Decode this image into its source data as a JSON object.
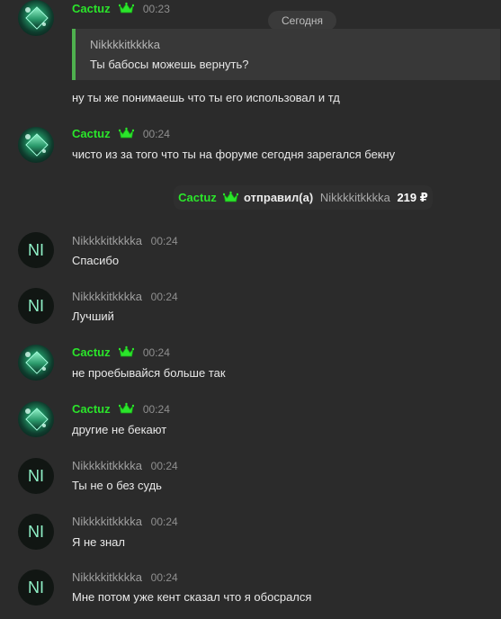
{
  "date_divider": "Сегодня",
  "messages": [
    {
      "author": "Cactuz",
      "time": "00:23",
      "reply": {
        "author": "Nikkkkitkkkka",
        "text": "Ты бабосы можешь вернуть?"
      },
      "text": "ну ты же понимаешь что ты его использовал и тд"
    },
    {
      "author": "Cactuz",
      "time": "00:24",
      "text": "чисто из за того что ты на форуме сегодня зарегался бекну"
    },
    {
      "author": "Nikkkkitkkkka",
      "time": "00:24",
      "text": "Спасибо",
      "avatar_initials": "NI"
    },
    {
      "author": "Nikkkkitkkkka",
      "time": "00:24",
      "text": "Лучший",
      "avatar_initials": "NI"
    },
    {
      "author": "Cactuz",
      "time": "00:24",
      "text": "не проебывайся больше так"
    },
    {
      "author": "Cactuz",
      "time": "00:24",
      "text": "другие не бекают"
    },
    {
      "author": "Nikkkkitkkkka",
      "time": "00:24",
      "text": "Ты не о без судь",
      "avatar_initials": "NI"
    },
    {
      "author": "Nikkkkitkkkka",
      "time": "00:24",
      "text": "Я не знал",
      "avatar_initials": "NI"
    },
    {
      "author": "Nikkkkitkkkka",
      "time": "00:24",
      "text": "Мне потом уже кент сказал что я обосрался",
      "avatar_initials": "NI"
    }
  ],
  "transfer": {
    "from": "Cactuz",
    "action": "отправил(а)",
    "to": "Nikkkkitkkkka",
    "amount": "219 ₽"
  },
  "colors": {
    "background": "#2b2b2b",
    "cactus_name": "#2be52b",
    "reply_bar": "#4fb14f",
    "secondary_text": "#9f9f9f",
    "ni_initials": "#8ff0c6"
  },
  "icons": {
    "crown": "crown-icon"
  }
}
